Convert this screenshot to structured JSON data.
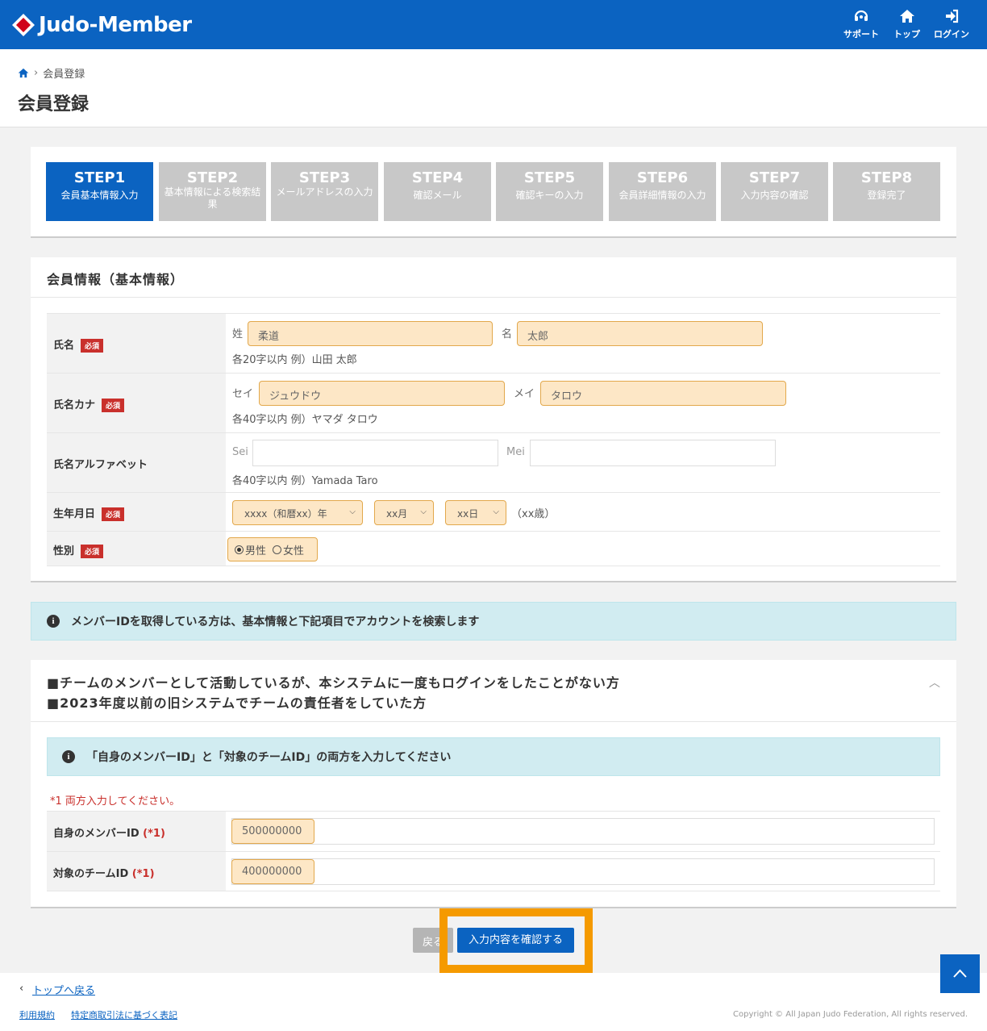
{
  "header": {
    "logo_text": "Judo-Member",
    "nav": [
      {
        "label": "サポート",
        "icon": "headset-icon"
      },
      {
        "label": "トップ",
        "icon": "home-icon"
      },
      {
        "label": "ログイン",
        "icon": "login-icon"
      }
    ]
  },
  "breadcrumb": {
    "current": "会員登録"
  },
  "page_title": "会員登録",
  "steps": [
    {
      "num": "STEP1",
      "label": "会員基本情報入力",
      "active": true
    },
    {
      "num": "STEP2",
      "label": "基本情報による検索結果"
    },
    {
      "num": "STEP3",
      "label": "メールアドレスの入力"
    },
    {
      "num": "STEP4",
      "label": "確認メール"
    },
    {
      "num": "STEP5",
      "label": "確認キーの入力"
    },
    {
      "num": "STEP6",
      "label": "会員詳細情報の入力"
    },
    {
      "num": "STEP7",
      "label": "入力内容の確認"
    },
    {
      "num": "STEP8",
      "label": "登録完了"
    }
  ],
  "basic_info": {
    "title": "会員情報（基本情報）",
    "required_badge": "必須",
    "name": {
      "label": "氏名",
      "last_label": "姓",
      "last_value": "柔道",
      "first_label": "名",
      "first_value": "太郎",
      "hint": "各20字以内 例）山田 太郎"
    },
    "kana": {
      "label": "氏名カナ",
      "last_label": "セイ",
      "last_value": "ジュウドウ",
      "first_label": "メイ",
      "first_value": "タロウ",
      "hint": "各40字以内 例）ヤマダ タロウ"
    },
    "alpha": {
      "label": "氏名アルファベット",
      "last_label": "Sei",
      "last_value": "",
      "first_label": "Mei",
      "first_value": "",
      "hint": "各40字以内 例）Yamada Taro"
    },
    "birth": {
      "label": "生年月日",
      "year": "xxxx（和暦xx）年",
      "month": "xx月",
      "day": "xx日",
      "age": "（xx歳）"
    },
    "gender": {
      "label": "性別",
      "male": "男性",
      "female": "女性",
      "selected": "男性"
    }
  },
  "notice": "メンバーIDを取得している方は、基本情報と下記項目でアカウントを検索します",
  "legacy": {
    "heading1": "■チームのメンバーとして活動しているが、本システムに一度もログインをしたことがない方",
    "heading2": "■2023年度以前の旧システムでチームの責任者をしていた方",
    "alert": "「自身のメンバーID」と「対象のチームID」の両方を入力してください",
    "note": "*1 両方入力してください。",
    "member_id_label": "自身のメンバーID",
    "member_id_mark": "(*1)",
    "member_id_value": "500000000",
    "team_id_label": "対象のチームID",
    "team_id_mark": "(*1)",
    "team_id_value": "400000000"
  },
  "buttons": {
    "back": "戻る",
    "confirm": "入力内容を確認する"
  },
  "footer": {
    "back_to_top": "トップへ戻る",
    "terms": "利用規約",
    "commerce": "特定商取引法に基づく表記",
    "copyright": "Copyright © All Japan Judo Federation, All rights reserved."
  },
  "colors": {
    "brand": "#0b63c1",
    "step_inactive": "#c8c8c8",
    "input_highlight": "#fde7c6",
    "required": "#c9302c",
    "highlight_box": "#f59a00"
  }
}
